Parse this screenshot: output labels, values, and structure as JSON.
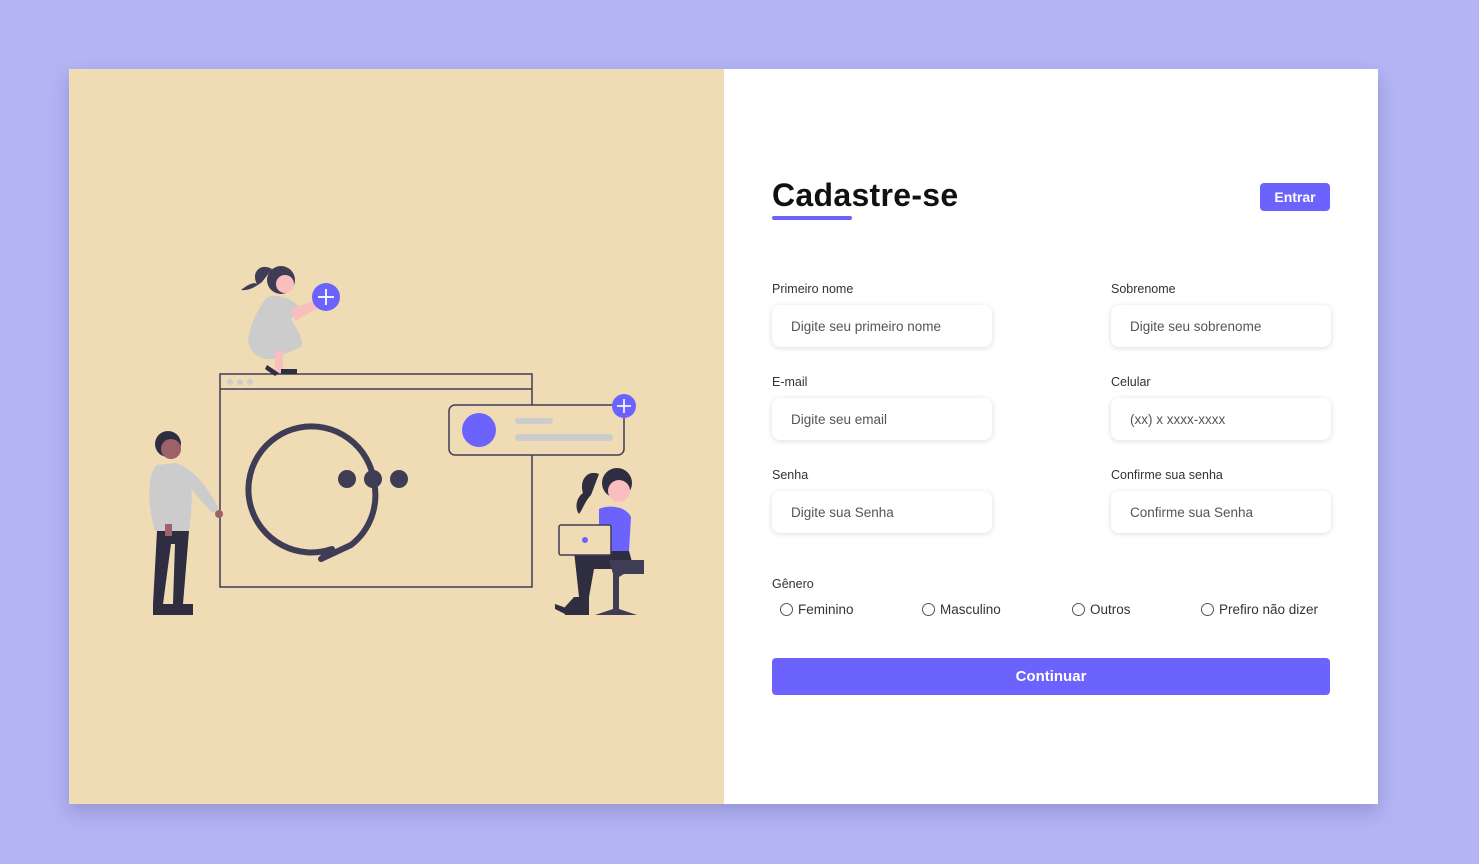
{
  "form": {
    "title": "Cadastre-se",
    "login_button": "Entrar",
    "fields": [
      {
        "label": "Primeiro nome",
        "placeholder": "Digite seu primeiro nome",
        "value": ""
      },
      {
        "label": "Sobrenome",
        "placeholder": "Digite seu sobrenome",
        "value": ""
      },
      {
        "label": "E-mail",
        "placeholder": "Digite seu email",
        "value": ""
      },
      {
        "label": "Celular",
        "placeholder": "(xx) x xxxx-xxxx",
        "value": ""
      },
      {
        "label": "Senha",
        "placeholder": "Digite sua Senha",
        "value": ""
      },
      {
        "label": "Confirme sua senha",
        "placeholder": "Confirme sua Senha",
        "value": ""
      }
    ],
    "gender": {
      "label": "Gênero",
      "options": [
        "Feminino",
        "Masculino",
        "Outros",
        "Prefiro não dizer"
      ],
      "selected": null
    },
    "submit_button": "Continuar"
  },
  "colors": {
    "background": "#b4b4f5",
    "accent": "#6c63ff",
    "illustration_panel": "#f0dcb4",
    "dark": "#3f3d56"
  },
  "illustration": {
    "icons": [
      "chat-bubble-icon",
      "plus-icon",
      "plus-icon"
    ]
  }
}
